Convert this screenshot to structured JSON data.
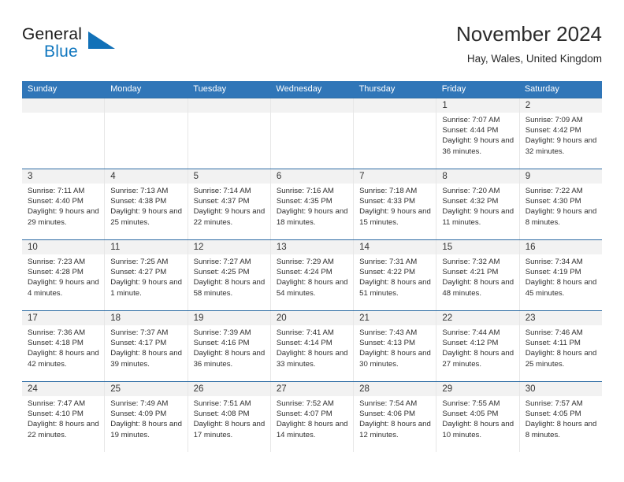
{
  "brand": {
    "name_part1": "General",
    "name_part2": "Blue",
    "logo_icon": "triangle-logo-icon"
  },
  "header": {
    "title": "November 2024",
    "location": "Hay, Wales, United Kingdom"
  },
  "calendar": {
    "weekdays": [
      "Sunday",
      "Monday",
      "Tuesday",
      "Wednesday",
      "Thursday",
      "Friday",
      "Saturday"
    ],
    "header_background": "#3076b8",
    "daynum_background": "#f2f2f2",
    "weeks": [
      [
        {
          "day": "",
          "sunrise": "",
          "sunset": "",
          "daylight": "",
          "empty": true
        },
        {
          "day": "",
          "sunrise": "",
          "sunset": "",
          "daylight": "",
          "empty": true
        },
        {
          "day": "",
          "sunrise": "",
          "sunset": "",
          "daylight": "",
          "empty": true
        },
        {
          "day": "",
          "sunrise": "",
          "sunset": "",
          "daylight": "",
          "empty": true
        },
        {
          "day": "",
          "sunrise": "",
          "sunset": "",
          "daylight": "",
          "empty": true
        },
        {
          "day": "1",
          "sunrise": "Sunrise: 7:07 AM",
          "sunset": "Sunset: 4:44 PM",
          "daylight": "Daylight: 9 hours and 36 minutes."
        },
        {
          "day": "2",
          "sunrise": "Sunrise: 7:09 AM",
          "sunset": "Sunset: 4:42 PM",
          "daylight": "Daylight: 9 hours and 32 minutes."
        }
      ],
      [
        {
          "day": "3",
          "sunrise": "Sunrise: 7:11 AM",
          "sunset": "Sunset: 4:40 PM",
          "daylight": "Daylight: 9 hours and 29 minutes."
        },
        {
          "day": "4",
          "sunrise": "Sunrise: 7:13 AM",
          "sunset": "Sunset: 4:38 PM",
          "daylight": "Daylight: 9 hours and 25 minutes."
        },
        {
          "day": "5",
          "sunrise": "Sunrise: 7:14 AM",
          "sunset": "Sunset: 4:37 PM",
          "daylight": "Daylight: 9 hours and 22 minutes."
        },
        {
          "day": "6",
          "sunrise": "Sunrise: 7:16 AM",
          "sunset": "Sunset: 4:35 PM",
          "daylight": "Daylight: 9 hours and 18 minutes."
        },
        {
          "day": "7",
          "sunrise": "Sunrise: 7:18 AM",
          "sunset": "Sunset: 4:33 PM",
          "daylight": "Daylight: 9 hours and 15 minutes."
        },
        {
          "day": "8",
          "sunrise": "Sunrise: 7:20 AM",
          "sunset": "Sunset: 4:32 PM",
          "daylight": "Daylight: 9 hours and 11 minutes."
        },
        {
          "day": "9",
          "sunrise": "Sunrise: 7:22 AM",
          "sunset": "Sunset: 4:30 PM",
          "daylight": "Daylight: 9 hours and 8 minutes."
        }
      ],
      [
        {
          "day": "10",
          "sunrise": "Sunrise: 7:23 AM",
          "sunset": "Sunset: 4:28 PM",
          "daylight": "Daylight: 9 hours and 4 minutes."
        },
        {
          "day": "11",
          "sunrise": "Sunrise: 7:25 AM",
          "sunset": "Sunset: 4:27 PM",
          "daylight": "Daylight: 9 hours and 1 minute."
        },
        {
          "day": "12",
          "sunrise": "Sunrise: 7:27 AM",
          "sunset": "Sunset: 4:25 PM",
          "daylight": "Daylight: 8 hours and 58 minutes."
        },
        {
          "day": "13",
          "sunrise": "Sunrise: 7:29 AM",
          "sunset": "Sunset: 4:24 PM",
          "daylight": "Daylight: 8 hours and 54 minutes."
        },
        {
          "day": "14",
          "sunrise": "Sunrise: 7:31 AM",
          "sunset": "Sunset: 4:22 PM",
          "daylight": "Daylight: 8 hours and 51 minutes."
        },
        {
          "day": "15",
          "sunrise": "Sunrise: 7:32 AM",
          "sunset": "Sunset: 4:21 PM",
          "daylight": "Daylight: 8 hours and 48 minutes."
        },
        {
          "day": "16",
          "sunrise": "Sunrise: 7:34 AM",
          "sunset": "Sunset: 4:19 PM",
          "daylight": "Daylight: 8 hours and 45 minutes."
        }
      ],
      [
        {
          "day": "17",
          "sunrise": "Sunrise: 7:36 AM",
          "sunset": "Sunset: 4:18 PM",
          "daylight": "Daylight: 8 hours and 42 minutes."
        },
        {
          "day": "18",
          "sunrise": "Sunrise: 7:37 AM",
          "sunset": "Sunset: 4:17 PM",
          "daylight": "Daylight: 8 hours and 39 minutes."
        },
        {
          "day": "19",
          "sunrise": "Sunrise: 7:39 AM",
          "sunset": "Sunset: 4:16 PM",
          "daylight": "Daylight: 8 hours and 36 minutes."
        },
        {
          "day": "20",
          "sunrise": "Sunrise: 7:41 AM",
          "sunset": "Sunset: 4:14 PM",
          "daylight": "Daylight: 8 hours and 33 minutes."
        },
        {
          "day": "21",
          "sunrise": "Sunrise: 7:43 AM",
          "sunset": "Sunset: 4:13 PM",
          "daylight": "Daylight: 8 hours and 30 minutes."
        },
        {
          "day": "22",
          "sunrise": "Sunrise: 7:44 AM",
          "sunset": "Sunset: 4:12 PM",
          "daylight": "Daylight: 8 hours and 27 minutes."
        },
        {
          "day": "23",
          "sunrise": "Sunrise: 7:46 AM",
          "sunset": "Sunset: 4:11 PM",
          "daylight": "Daylight: 8 hours and 25 minutes."
        }
      ],
      [
        {
          "day": "24",
          "sunrise": "Sunrise: 7:47 AM",
          "sunset": "Sunset: 4:10 PM",
          "daylight": "Daylight: 8 hours and 22 minutes."
        },
        {
          "day": "25",
          "sunrise": "Sunrise: 7:49 AM",
          "sunset": "Sunset: 4:09 PM",
          "daylight": "Daylight: 8 hours and 19 minutes."
        },
        {
          "day": "26",
          "sunrise": "Sunrise: 7:51 AM",
          "sunset": "Sunset: 4:08 PM",
          "daylight": "Daylight: 8 hours and 17 minutes."
        },
        {
          "day": "27",
          "sunrise": "Sunrise: 7:52 AM",
          "sunset": "Sunset: 4:07 PM",
          "daylight": "Daylight: 8 hours and 14 minutes."
        },
        {
          "day": "28",
          "sunrise": "Sunrise: 7:54 AM",
          "sunset": "Sunset: 4:06 PM",
          "daylight": "Daylight: 8 hours and 12 minutes."
        },
        {
          "day": "29",
          "sunrise": "Sunrise: 7:55 AM",
          "sunset": "Sunset: 4:05 PM",
          "daylight": "Daylight: 8 hours and 10 minutes."
        },
        {
          "day": "30",
          "sunrise": "Sunrise: 7:57 AM",
          "sunset": "Sunset: 4:05 PM",
          "daylight": "Daylight: 8 hours and 8 minutes."
        }
      ]
    ]
  }
}
